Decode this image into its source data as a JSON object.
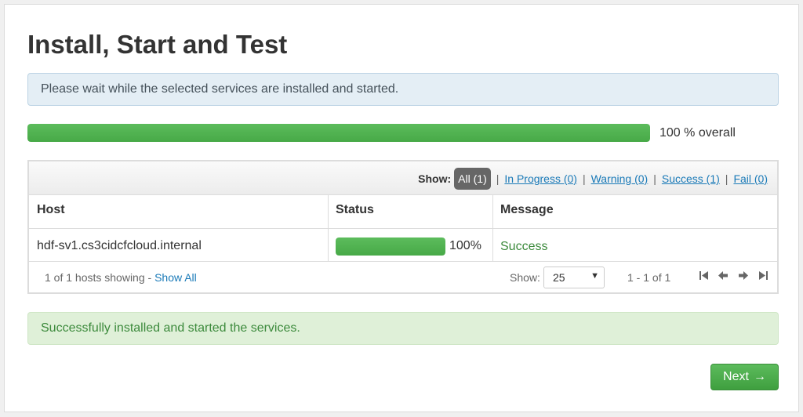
{
  "page": {
    "title": "Install, Start and Test"
  },
  "info_message": "Please wait while the selected services are installed and started.",
  "overall_progress": {
    "percent": 100,
    "label": "100 % overall"
  },
  "filters": {
    "label": "Show:",
    "items": [
      {
        "label": "All (1)",
        "active": true
      },
      {
        "label": "In Progress (0)",
        "active": false
      },
      {
        "label": "Warning (0)",
        "active": false
      },
      {
        "label": "Success (1)",
        "active": false
      },
      {
        "label": "Fail (0)",
        "active": false
      }
    ],
    "separator": "|"
  },
  "table": {
    "headers": {
      "host": "Host",
      "status": "Status",
      "message": "Message"
    },
    "rows": [
      {
        "host": "hdf-sv1.cs3cidcfcloud.internal",
        "progress": 100,
        "progress_label": "100%",
        "message": "Success"
      }
    ]
  },
  "footer": {
    "hosts_showing": "1 of 1 hosts showing - ",
    "show_all": "Show All",
    "show_label": "Show:",
    "page_size": "25",
    "range": "1 - 1 of 1"
  },
  "success_message": "Successfully installed and started the services.",
  "next_button": {
    "label": "Next",
    "arrow": "→"
  },
  "colors": {
    "progress_green": "#47a947",
    "link_blue": "#1a7ab8",
    "success_text": "#3c8a3c",
    "button_green": "#4cae4c"
  }
}
